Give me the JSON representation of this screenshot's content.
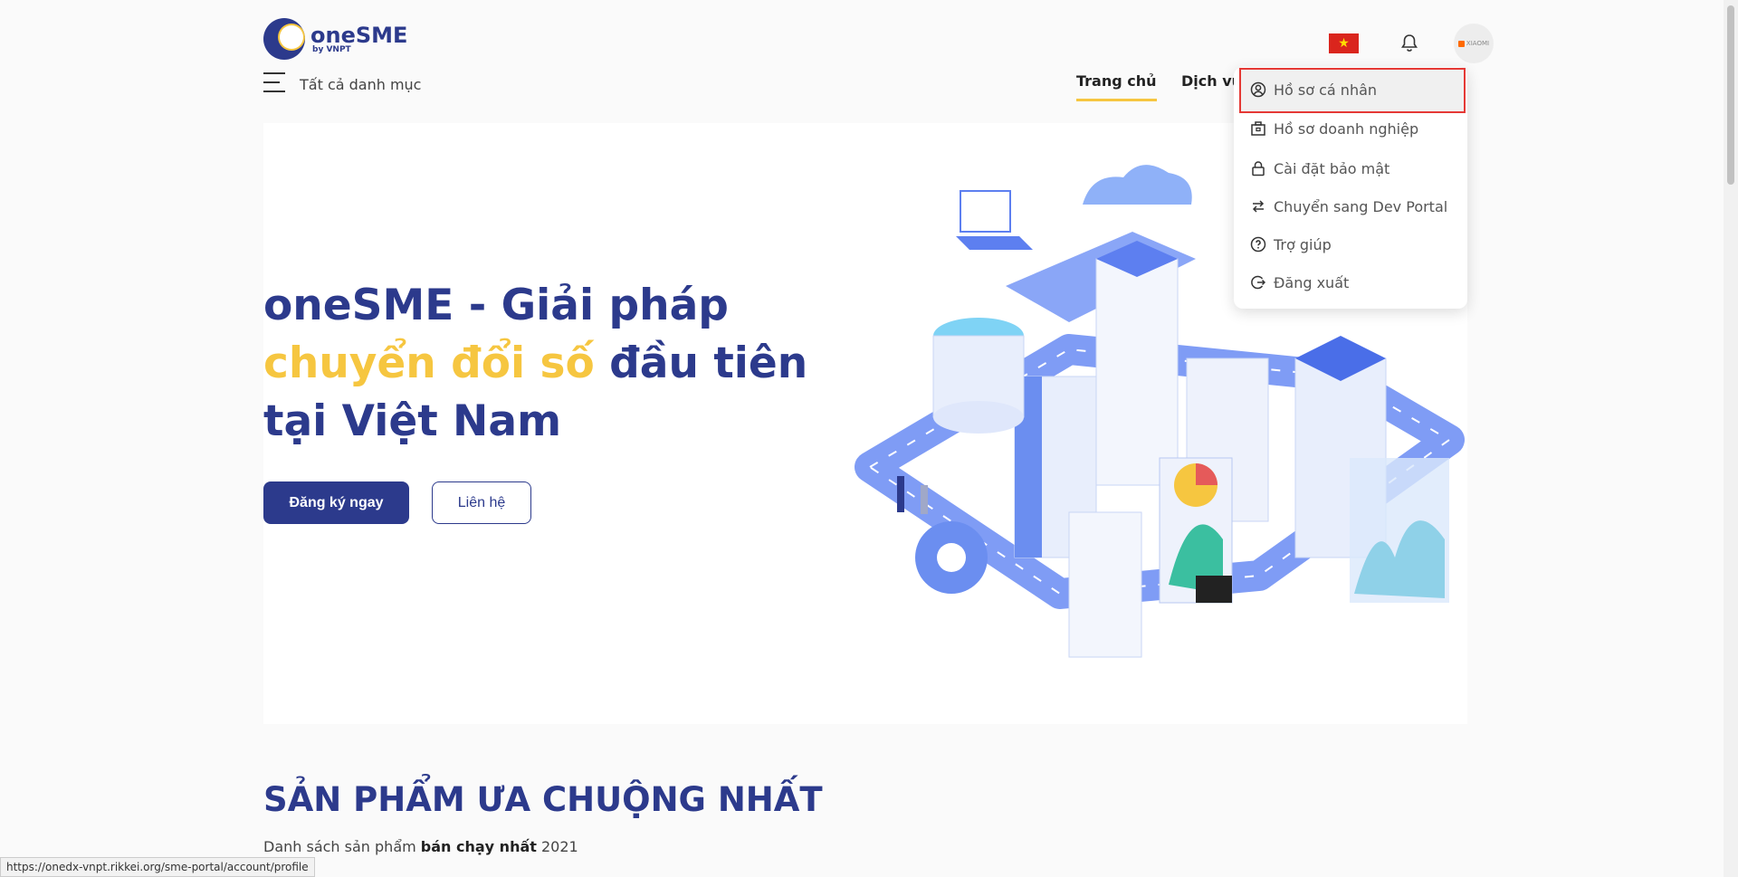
{
  "header": {
    "logo_name": "oneSME",
    "logo_sub": "by VNPT",
    "flag_star": "★",
    "avatar_label": "XIAOMI"
  },
  "nav": {
    "categories_label": "Tất cả danh mục",
    "home_label": "Trang chủ",
    "services_label": "Dịch vụ"
  },
  "hero": {
    "title_line1": "oneSME - Giải pháp",
    "title_highlight": "chuyển đổi số",
    "title_rest": " đầu tiên",
    "title_line3": "tại Việt Nam",
    "register_button": "Đăng ký ngay",
    "contact_button": "Liên hệ"
  },
  "section": {
    "title": "SẢN PHẨM ƯA CHUỘNG NHẤT",
    "sub_prefix": "Danh sách sản phẩm ",
    "sub_bold": "bán chạy nhất",
    "sub_suffix": " 2021"
  },
  "account_menu": {
    "items": [
      {
        "label": "Hồ sơ cá nhân",
        "icon": "user-circle-icon"
      },
      {
        "label": "Hồ sơ doanh nghiệp",
        "icon": "briefcase-icon"
      },
      {
        "label": "Cài đặt bảo mật",
        "icon": "lock-icon"
      },
      {
        "label": "Chuyển sang Dev Portal",
        "icon": "swap-icon"
      },
      {
        "label": "Trợ giúp",
        "icon": "help-circle-icon"
      },
      {
        "label": "Đăng xuất",
        "icon": "logout-icon"
      }
    ]
  },
  "status_bar": {
    "url": "https://onedx-vnpt.rikkei.org/sme-portal/account/profile"
  },
  "colors": {
    "brand": "#2c3a8c",
    "accent": "#f6c640",
    "highlight_border": "#e53935"
  }
}
